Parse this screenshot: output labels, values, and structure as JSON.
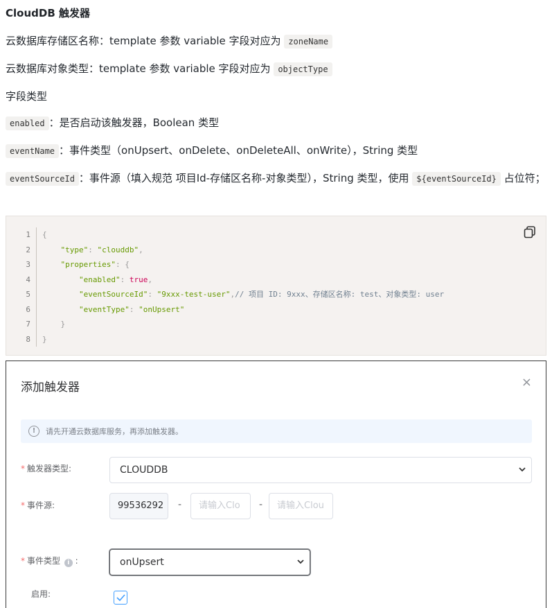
{
  "doc": {
    "heading": "CloudDB 触发器",
    "zone_prefix": "云数据库存储区名称：template 参数 variable 字段对应为",
    "zone_code": "zoneName",
    "objtype_prefix": "云数据库对象类型：template 参数 variable 字段对应为",
    "objtype_code": "objectType",
    "field_types": "字段类型",
    "enabled_code": "enabled",
    "enabled_desc": "：是否启动该触发器，Boolean 类型",
    "eventname_code": "eventName",
    "eventname_desc": "：事件类型（onUpsert、onDelete、onDeleteAll、onWrite），String 类型",
    "eventsource_code": "eventSourceId",
    "eventsource_desc": "：事件源（填入规范 项目Id-存储区名称-对象类型），String 类型，使用",
    "placeholder_code": "${eventSourceId}",
    "eventsource_tail": "占位符；"
  },
  "code": {
    "line_numbers": [
      "1",
      "2",
      "3",
      "4",
      "5",
      "6",
      "7",
      "8"
    ],
    "l1": "{",
    "l2_key": "\"type\"",
    "l2_val": "\"clouddb\"",
    "l3_key": "\"properties\"",
    "l3_rest": ": {",
    "l4_key": "\"enabled\"",
    "l4_val": "true",
    "l5_key": "\"eventSourceId\"",
    "l5_val": "\"9xxx-test-user\"",
    "l5_comment": "// 项目 ID: 9xxx、存储区名称: test、对象类型: user",
    "l6_key": "\"eventType\"",
    "l6_val": "\"onUpsert\"",
    "l7": "}",
    "l8": "}"
  },
  "dialog": {
    "title": "添加触发器",
    "close": "×",
    "alert": "请先开通云数据库服务，再添加触发器。",
    "trigger_type_label": "触发器类型:",
    "trigger_type_value": "CLOUDDB",
    "event_source_label": "事件源:",
    "event_source_project": "99536292",
    "dash": "-",
    "zone_placeholder": "请输入Clo",
    "object_placeholder": "请输入Clou",
    "event_type_label": "事件类型",
    "event_type_value": "onUpsert",
    "enable_label": "启用:",
    "required_mark": "*"
  },
  "icons": {
    "copy": "copy-icon",
    "close": "close-icon",
    "alert": "info-circle-icon",
    "chevron": "chevron-down-icon",
    "check": "check-icon"
  }
}
